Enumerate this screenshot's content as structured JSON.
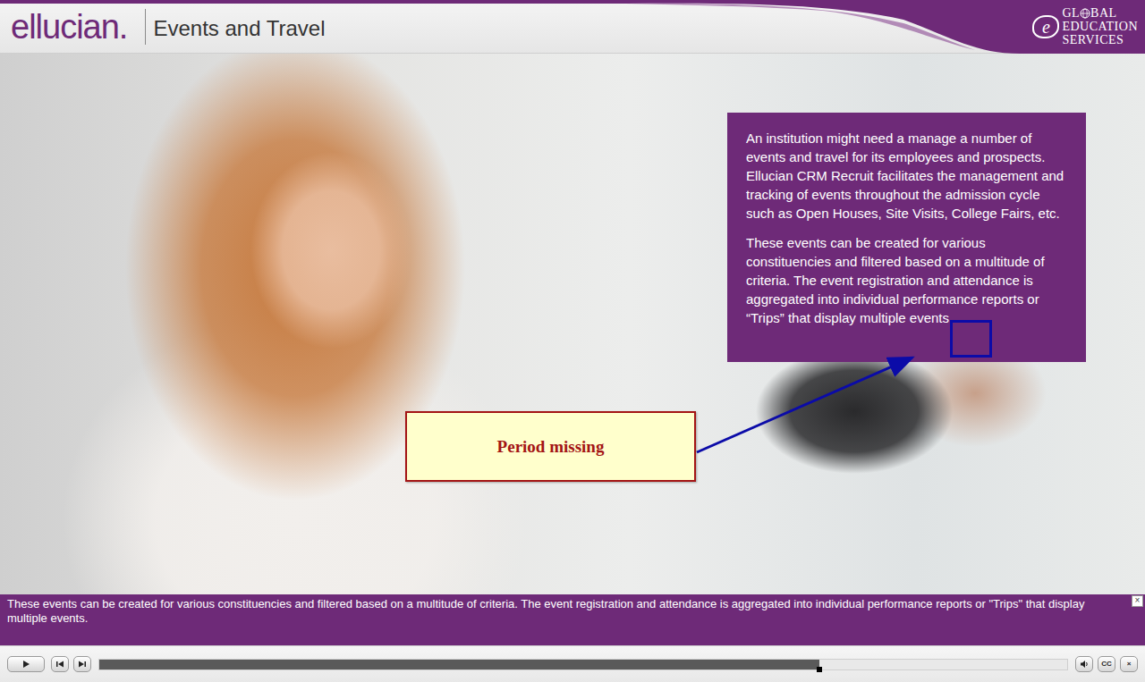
{
  "header": {
    "logo": "ellucian.",
    "title": "Events and Travel",
    "partner_logo": {
      "mark": "e",
      "line1_start": "GL",
      "line1_end": "BAL",
      "line2": "EDUCATION",
      "line3": "SERVICES"
    }
  },
  "slide": {
    "paragraphs": [
      "An institution might need a manage a number of events and travel for its employees and prospects. Ellucian CRM Recruit facilitates the management and tracking of events throughout the admission cycle such as Open Houses, Site Visits, College Fairs, etc.",
      "These events can be created for various constituencies and filtered based on a multitude of criteria. The event registration and attendance is aggregated into individual performance reports or “Trips” that display multiple events"
    ]
  },
  "annotation": {
    "label": "Period missing"
  },
  "caption": {
    "text": "These events can be created for various constituencies and filtered based on a multitude of criteria. The event registration and attendance is aggregated into individual performance reports or \"Trips\" that display multiple events.",
    "close": "×"
  },
  "player": {
    "progress": {
      "level": 0.744
    },
    "left_controls": [
      {
        "kind": "play"
      },
      {
        "kind": "previous"
      },
      {
        "kind": "next"
      }
    ],
    "right_controls": [
      {
        "kind": "volume"
      },
      {
        "kind": "text",
        "label": "CC"
      },
      {
        "kind": "text",
        "label": "×"
      }
    ]
  }
}
